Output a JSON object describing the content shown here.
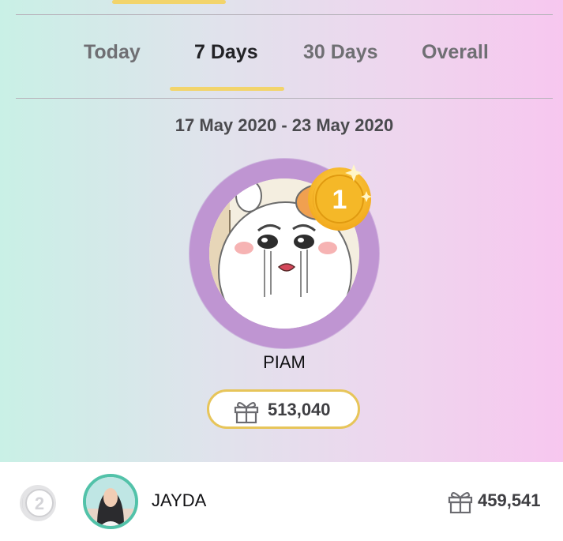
{
  "tabs": [
    {
      "label": "Today",
      "active": false
    },
    {
      "label": "7 Days",
      "active": true
    },
    {
      "label": "30 Days",
      "active": false
    },
    {
      "label": "Overall",
      "active": false
    }
  ],
  "date_range": "17 May 2020 - 23 May 2020",
  "top_ranker": {
    "rank_badge": "1",
    "name": "PIAM",
    "score": "513,040",
    "score_icon": "gift-icon",
    "medal_icon": "gold-medal-icon"
  },
  "ranking_list": [
    {
      "rank": "2",
      "rank_icon": "silver-medal-icon",
      "name": "JAYDA",
      "score": "459,541",
      "score_icon": "gift-icon"
    }
  ],
  "colors": {
    "accent_yellow": "#f2d46b",
    "avatar_ring": "#bf95d2",
    "pill_border": "#e7c55a",
    "row_avatar_border": "#52c2a9",
    "gradient_left": "#c9f0e6",
    "gradient_right": "#f7c7ef"
  }
}
